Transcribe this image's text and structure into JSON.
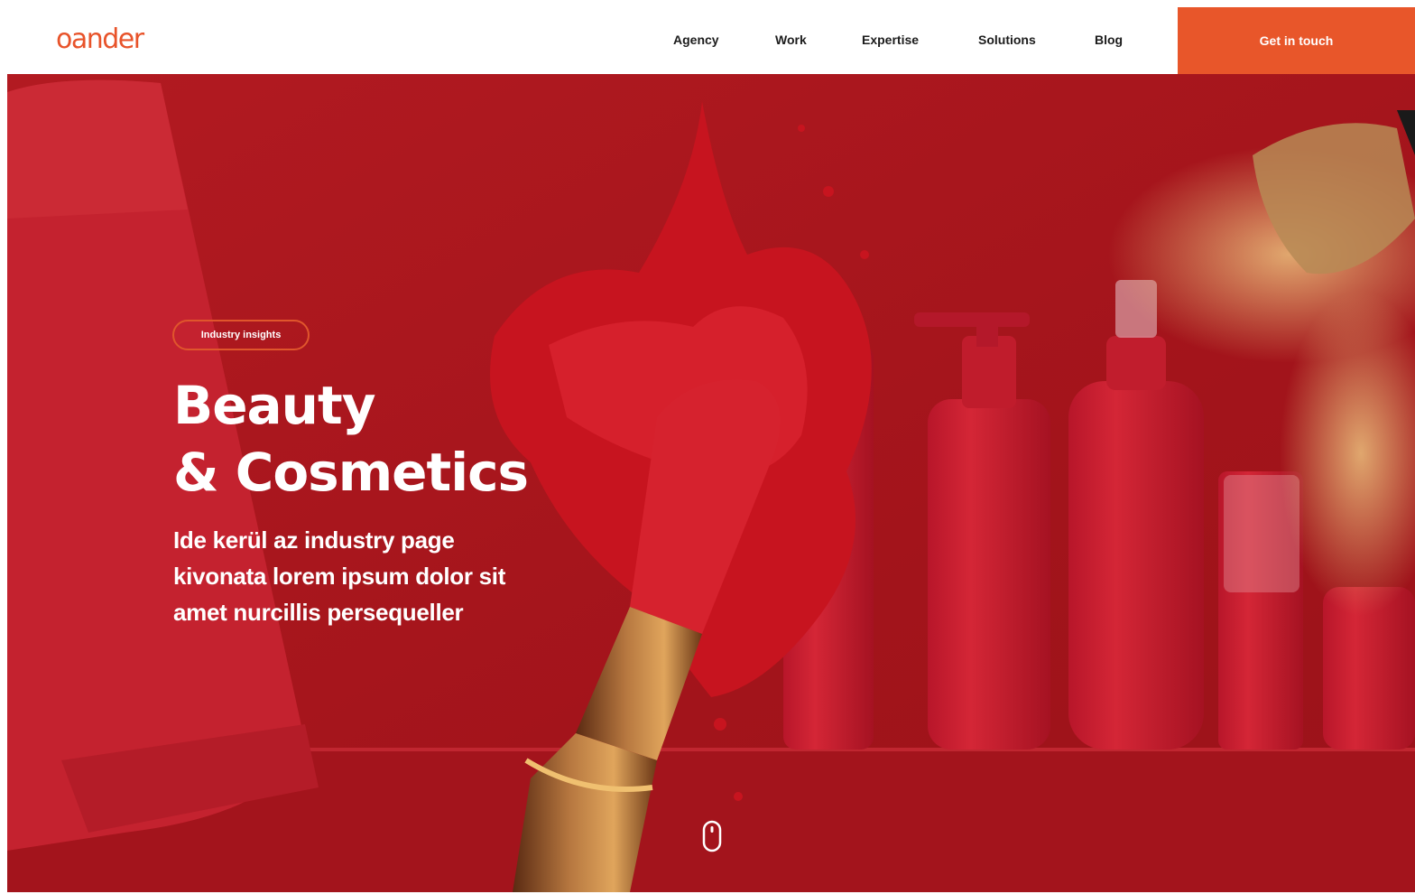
{
  "brand": {
    "logo_text": "oander",
    "accent_color": "#e8562a"
  },
  "nav": {
    "items": [
      {
        "label": "Agency"
      },
      {
        "label": "Work"
      },
      {
        "label": "Expertise"
      },
      {
        "label": "Solutions"
      },
      {
        "label": "Blog"
      }
    ],
    "cta_label": "Get in touch"
  },
  "hero": {
    "badge": "Industry insights",
    "title_line1": "Beauty",
    "title_line2": "& Cosmetics",
    "description": "Ide kerül az industry page kivonata lorem ipsum dolor sit amet nurcillis persequeller",
    "background_color": "#a9161d",
    "scroll_icon": "mouse-scroll-icon"
  }
}
